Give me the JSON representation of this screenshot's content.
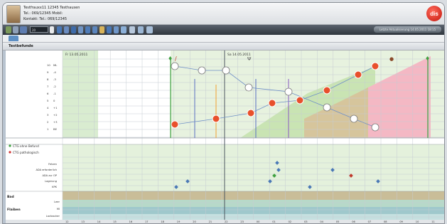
{
  "patient": {
    "line1": "Testfrauxx11 12345 Testhausen",
    "line2": "Tel.: 069/12345  Mobil:",
    "line3": "Kontakt:  Tel.: 069/12345"
  },
  "logo": {
    "text": "dis"
  },
  "toolbar": {
    "select_value": "20 Stunden",
    "right_text": "Letzte Aktualisierung 14.05.2011 18:15"
  },
  "section": {
    "title": "Testbefunde"
  },
  "chart": {
    "date1": "Fr 13.05.2011",
    "date2": "Sa 14.05.2011",
    "left_numbers": [
      "10",
      "9",
      "8",
      "7",
      "6",
      "5",
      "4",
      "3",
      "2",
      "1"
    ],
    "station_labels": [
      "ML",
      "-4",
      "-3",
      "-2",
      "-1",
      "0",
      "+1",
      "+2",
      "+3",
      "BE"
    ],
    "legend1": "CTG ohne Befund",
    "legend2": "CTG pathologisch",
    "row_labels": [
      "Fetzen",
      "ADA erforderlich",
      "ADA zur OP",
      "Lagerung",
      "KPK"
    ],
    "lower_group1": "Bad",
    "lower_group2": "Flaiben",
    "lower_labels": [
      "Leer",
      "MI",
      "Lactoscker"
    ],
    "time_labels": [
      "12",
      "13",
      "14",
      "15",
      "16",
      "17",
      "18",
      "19",
      "20",
      "21",
      "22",
      "23",
      "00",
      "01",
      "02",
      "03",
      "04",
      "05",
      "06",
      "07",
      "08",
      "09",
      "10",
      "11",
      "12"
    ]
  },
  "colors": {
    "green_zone": "#d9ecd0",
    "red_zone": "#f4b8c4",
    "olive_zone": "#c7b48a",
    "line": "#6e8fc7",
    "orange_circle": "#e8502c",
    "gray_circle": "#7a7a7a"
  }
}
